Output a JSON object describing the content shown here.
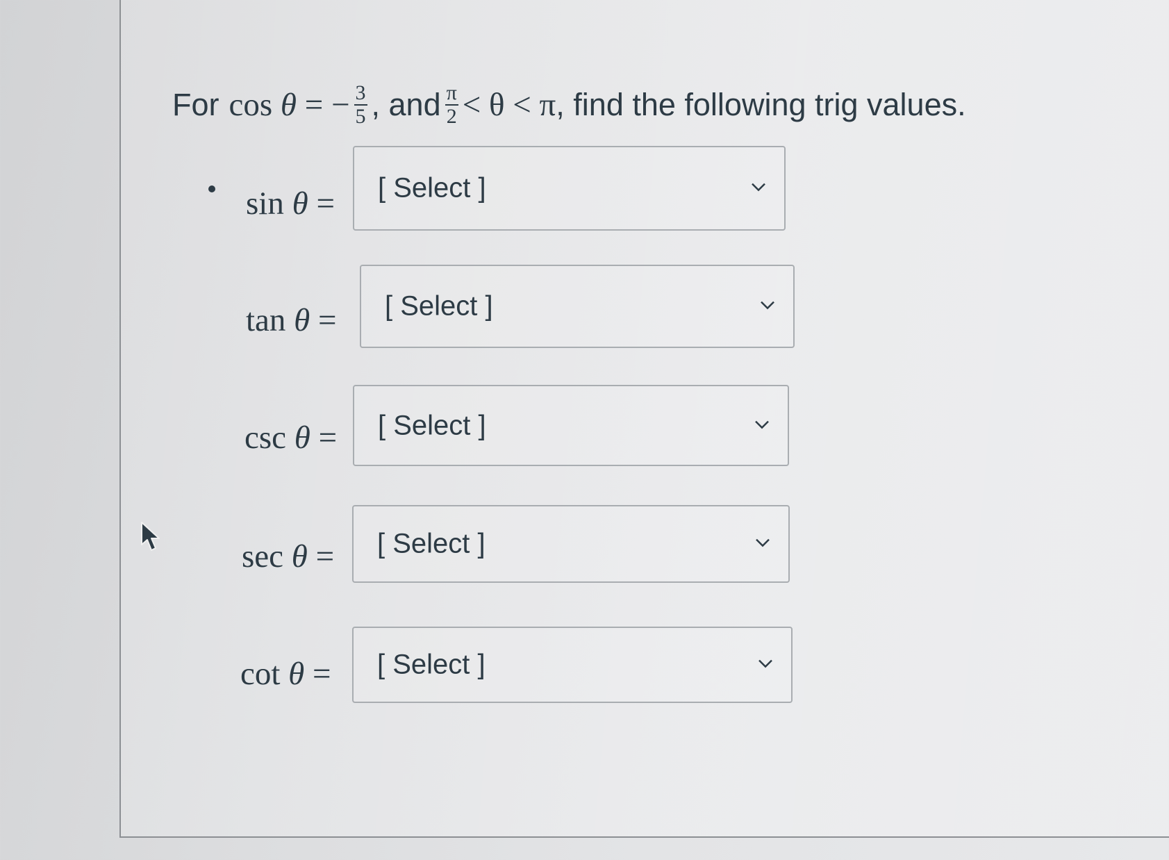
{
  "question": {
    "prefix": "For",
    "cos_word": "cos",
    "theta": "θ",
    "equals_neg": "= −",
    "frac1_num": "3",
    "frac1_den": "5",
    "and_text": ", and",
    "frac2_num": "π",
    "frac2_den": "2",
    "ineq_mid": "< θ < π",
    "suffix": ", find the following trig values."
  },
  "rows": [
    {
      "fn": "sin",
      "theta": "θ",
      "eq": "=",
      "value": "[ Select ]"
    },
    {
      "fn": "tan",
      "theta": "θ",
      "eq": "=",
      "value": "[ Select ]"
    },
    {
      "fn": "csc",
      "theta": "θ",
      "eq": "=",
      "value": "[ Select ]"
    },
    {
      "fn": "sec",
      "theta": "θ",
      "eq": "=",
      "value": "[ Select ]"
    },
    {
      "fn": "cot",
      "theta": "θ",
      "eq": "=",
      "value": "[ Select ]"
    }
  ],
  "icons": {
    "chevron": "chevron-down-icon",
    "cursor": "mouse-pointer-icon"
  },
  "colors": {
    "text": "#2d3b45",
    "select_border": "#a9adb1"
  }
}
